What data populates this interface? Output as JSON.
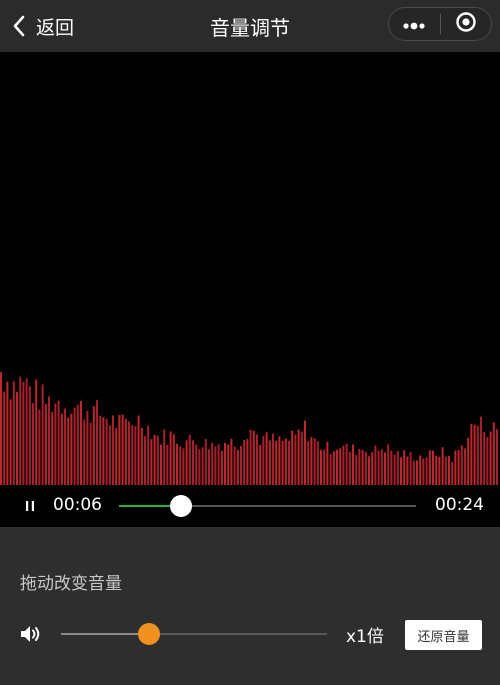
{
  "header": {
    "back_label": "返回",
    "title": "音量调节",
    "back_icon": "chevron-left-icon",
    "more_icon": "more-dots-icon",
    "close_icon": "target-circle-icon"
  },
  "player": {
    "current_time": "00:06",
    "total_time": "00:24",
    "progress_fraction": 0.21,
    "progress_color": "#1fb53a",
    "pause_icon": "pause-icon"
  },
  "volume": {
    "label": "拖动改变音量",
    "level_fraction": 0.33,
    "multiplier": "x1倍",
    "reset_label": "还原音量",
    "thumb_color": "#f0901e",
    "speaker_icon": "speaker-icon"
  },
  "waveform": {
    "bar_color": "#c0272b",
    "levels": [
      0.68,
      0.6,
      0.62,
      0.55,
      0.5,
      0.5,
      0.48,
      0.46,
      0.45,
      0.42,
      0.38,
      0.36,
      0.4,
      0.35,
      0.28,
      0.3,
      0.26,
      0.27,
      0.25,
      0.24,
      0.26,
      0.25,
      0.35,
      0.28,
      0.27,
      0.26,
      0.28,
      0.34,
      0.25,
      0.22,
      0.24,
      0.21,
      0.22,
      0.2,
      0.23,
      0.19,
      0.18,
      0.17,
      0.18,
      0.2,
      0.16,
      0.24,
      0.37,
      0.35,
      0.33
    ]
  }
}
